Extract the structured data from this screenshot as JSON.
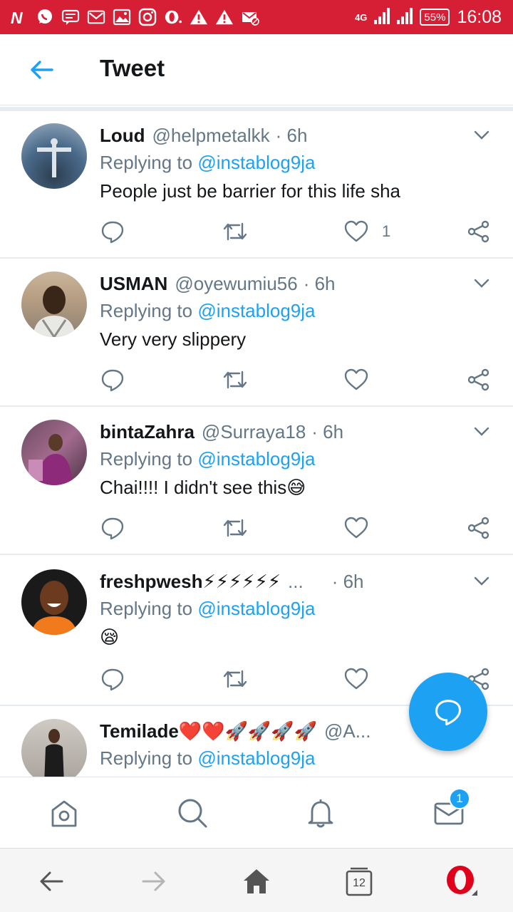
{
  "status_bar": {
    "network": "4G",
    "battery": "55%",
    "time": "16:08"
  },
  "header": {
    "title": "Tweet"
  },
  "tweets": [
    {
      "name": "Loud",
      "handle": "@helpmetalkk",
      "time": "· 6h",
      "replying_prefix": "Replying to",
      "replying_to": "@instablog9ja",
      "text": "People just be barrier for this life sha",
      "like_count": "1"
    },
    {
      "name": "USMAN",
      "handle": "@oyewumiu56",
      "time": "· 6h",
      "replying_prefix": "Replying to",
      "replying_to": "@instablog9ja",
      "text": "Very very slippery",
      "like_count": ""
    },
    {
      "name": "bintaZahra",
      "handle": "@Surraya18",
      "time": "· 6h",
      "replying_prefix": "Replying to",
      "replying_to": "@instablog9ja",
      "text": "Chai!!!! I didn't see this😅",
      "like_count": ""
    },
    {
      "name": "freshpwesh⚡⚡⚡⚡⚡⚡",
      "handle": "...",
      "time": "· 6h",
      "replying_prefix": "Replying to",
      "replying_to": "@instablog9ja",
      "text": "😪",
      "like_count": ""
    },
    {
      "name": "Temilade❤️❤️🚀🚀🚀🚀",
      "handle": "@A...",
      "time": "",
      "replying_prefix": "Replying to",
      "replying_to": "@instablog9ja",
      "text": "",
      "like_count": ""
    }
  ],
  "bottom_nav": {
    "messages_badge": "1"
  },
  "browser": {
    "tab_count": "12"
  },
  "colors": {
    "status_bar": "#d61f34",
    "accent": "#1da1f2",
    "secondary_text": "#657786"
  }
}
